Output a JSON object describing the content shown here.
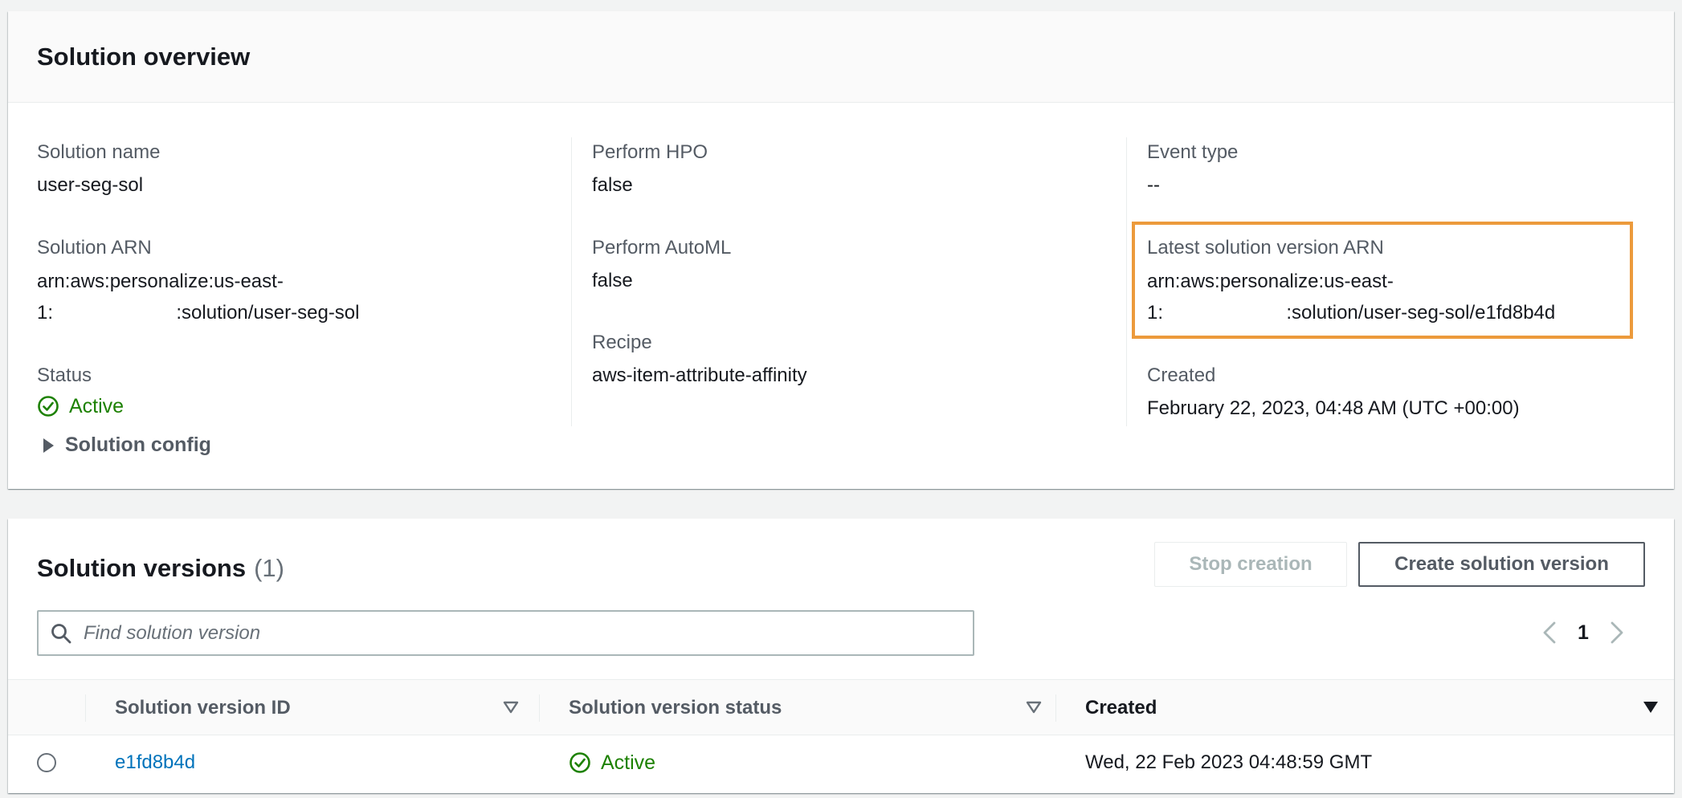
{
  "overview": {
    "title": "Solution overview",
    "solution_name": {
      "label": "Solution name",
      "value": "user-seg-sol"
    },
    "solution_arn": {
      "label": "Solution ARN",
      "line1": "arn:aws:personalize:us-east-",
      "line2": "1:                       :solution/user-seg-sol"
    },
    "status": {
      "label": "Status",
      "value": "Active"
    },
    "solution_config": "Solution config",
    "perform_hpo": {
      "label": "Perform HPO",
      "value": "false"
    },
    "perform_automl": {
      "label": "Perform AutoML",
      "value": "false"
    },
    "recipe": {
      "label": "Recipe",
      "value": "aws-item-attribute-affinity"
    },
    "event_type": {
      "label": "Event type",
      "value": "--"
    },
    "latest_version_arn": {
      "label": "Latest solution version ARN",
      "line1": "arn:aws:personalize:us-east-",
      "line2": "1:                       :solution/user-seg-sol/e1fd8b4d"
    },
    "created": {
      "label": "Created",
      "value": "February 22, 2023, 04:48 AM (UTC +00:00)"
    }
  },
  "versions": {
    "title": "Solution versions",
    "count": "(1)",
    "stop_button": "Stop creation",
    "create_button": "Create solution version",
    "search_placeholder": "Find solution version",
    "page": "1",
    "columns": [
      "Solution version ID",
      "Solution version status",
      "Created"
    ],
    "rows": [
      {
        "id": "e1fd8b4d",
        "status": "Active",
        "created": "Wed, 22 Feb 2023 04:48:59 GMT"
      }
    ]
  },
  "colors": {
    "success": "#1d8102",
    "link": "#0073bb",
    "highlight": "#ec9a3c"
  },
  "icons": [
    "check-circle-icon",
    "caret-right-icon",
    "search-icon",
    "chevron-left-icon",
    "chevron-right-icon",
    "sort-icon",
    "sort-desc-icon"
  ]
}
